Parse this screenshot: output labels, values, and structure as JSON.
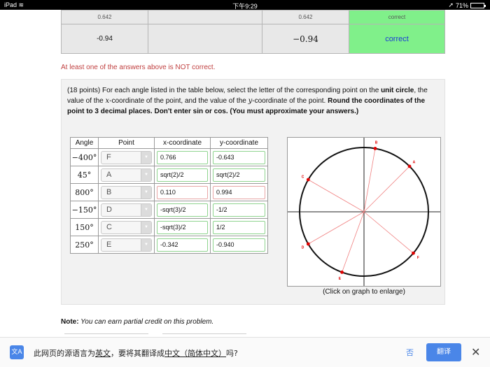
{
  "status_bar": {
    "device": "iPad",
    "wifi_icon": "wifi-icon",
    "time": "下午9:29",
    "location_icon": "location-arrow-icon",
    "battery_text": "71%",
    "battery_level": 0.71
  },
  "previous_results": {
    "top_row": [
      "0.642",
      "",
      "0.642",
      "correct"
    ],
    "row": {
      "entered": "-0.94",
      "preview": "−0.94",
      "result": "correct"
    }
  },
  "warning": "At least one of the answers above is NOT correct.",
  "problem": {
    "points": "(18 points)",
    "text_a": " For each angle listed in the table below, select the letter of the corresponding point on the ",
    "bold_a": "unit circle",
    "text_b": ", the value of the ",
    "var_x": "x",
    "text_c": "-coordinate of the point, and the value of the ",
    "var_y": "y",
    "text_d": "-coordinate of the point. ",
    "bold_b": "Round the coordinates of the point to 3 decimal places. Don't enter sin or cos. (You must approximate your answers.)"
  },
  "answer_table": {
    "headers": [
      "Angle",
      "Point",
      "x-coordinate",
      "y-coordinate"
    ],
    "rows": [
      {
        "angle": "−400°",
        "point": "F",
        "x": "0.766",
        "y": "-0.643",
        "x_ok": true,
        "y_ok": true
      },
      {
        "angle": "45°",
        "point": "A",
        "x": "sqrt(2)/2",
        "y": "sqrt(2)/2",
        "x_ok": true,
        "y_ok": true
      },
      {
        "angle": "800°",
        "point": "B",
        "x": "0.110",
        "y": "0.994",
        "x_ok": false,
        "y_ok": false
      },
      {
        "angle": "−150°",
        "point": "D",
        "x": "-sqrt(3)/2",
        "y": "-1/2",
        "x_ok": true,
        "y_ok": true
      },
      {
        "angle": "150°",
        "point": "C",
        "x": "-sqrt(3)/2",
        "y": "1/2",
        "x_ok": true,
        "y_ok": true
      },
      {
        "angle": "250°",
        "point": "E",
        "x": "-0.342",
        "y": "-0.940",
        "x_ok": true,
        "y_ok": true
      }
    ]
  },
  "graph": {
    "caption": "(Click on graph to enlarge)",
    "point_labels": [
      "B",
      "A",
      "C",
      "D",
      "E",
      "F"
    ],
    "point_angles_deg": [
      80,
      45,
      150,
      210,
      250,
      320
    ],
    "line_color": "#f08080",
    "point_color": "#e00000"
  },
  "note": {
    "label": "Note:",
    "text": " You can earn partial credit on this problem."
  },
  "translate_bar": {
    "icon": "translate-icon",
    "message_a": "此网页的源语言为",
    "source_lang": "英文",
    "message_b": "，要将其翻译成",
    "target_lang": "中文（简体中文）",
    "message_c": "吗?",
    "no_label": "否",
    "yes_label": "翻译",
    "close_icon": "close-icon"
  }
}
